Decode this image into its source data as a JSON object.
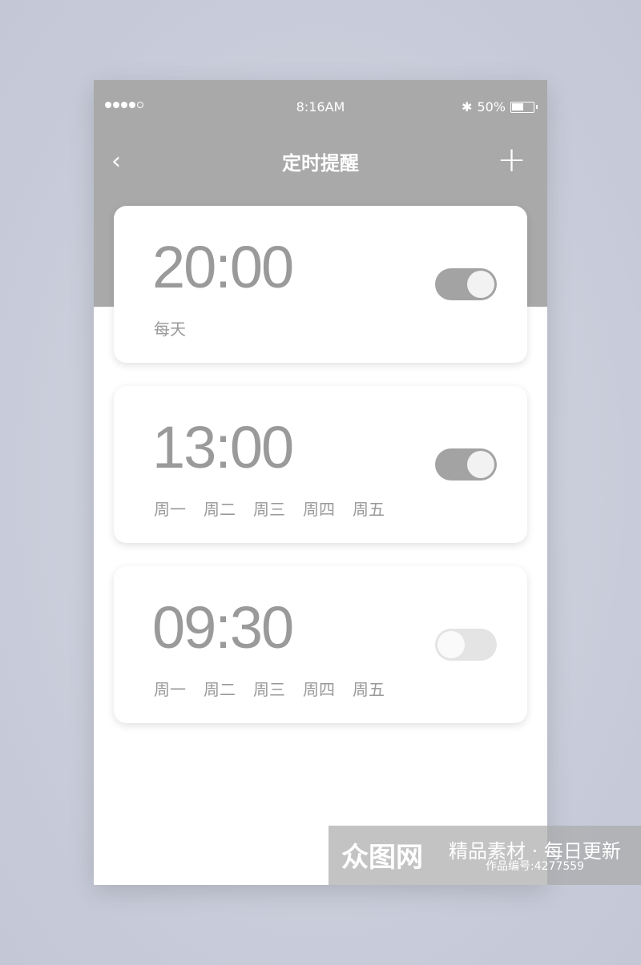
{
  "status_bar": {
    "signal": "●●●●○",
    "time": "8:16AM",
    "battery": "50%",
    "bluetooth_icon": "bluetooth-icon"
  },
  "nav": {
    "back_icon": "‹",
    "title": "定时提醒",
    "add_icon": "+"
  },
  "alarms": [
    {
      "time": "20:00",
      "days": [
        "每天"
      ],
      "enabled": true
    },
    {
      "time": "13:00",
      "days": [
        "周一",
        "周二",
        "周三",
        "周四",
        "周五"
      ],
      "enabled": true
    },
    {
      "time": "09:30",
      "days": [
        "周一",
        "周二",
        "周三",
        "周四",
        "周五"
      ],
      "enabled": false
    }
  ],
  "watermark": {
    "logo": "众图网",
    "slogan": "精品素材 · 每日更新",
    "id": "作品编号:4277559"
  },
  "colors": {
    "header": "#a9a9a9",
    "toggle_on": "#a3a3a3",
    "toggle_off": "#e4e4e4",
    "time_text": "#9a9a9a"
  }
}
